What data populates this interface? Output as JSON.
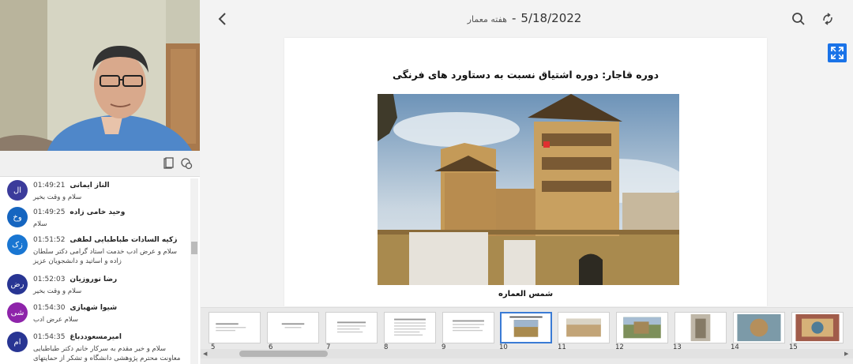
{
  "header": {
    "course_title": "هفته معمار",
    "separator": "-",
    "date": "5/18/2022",
    "icons": {
      "back": "chevron-left-icon",
      "search": "search-icon",
      "rotate": "rotate-icon",
      "fullscreen": "fullscreen-icon"
    }
  },
  "video_toolbar": {
    "icons": [
      "clipboard-icon",
      "chat-bubbles-icon"
    ]
  },
  "chat": {
    "messages": [
      {
        "avatar": "ال",
        "avatar_color": "#3b3b9b",
        "name": "الناز ایمانی",
        "time": "01:49:21",
        "text": "سلام و وقت بخیر"
      },
      {
        "avatar": "وخ",
        "avatar_color": "#1565c0",
        "name": "وحید خامی زاده",
        "time": "01:49:25",
        "text": "سلام"
      },
      {
        "avatar": "زک",
        "avatar_color": "#1976d2",
        "name": "زکیه السادات طباطبایی لطفی",
        "time": "01:51:52",
        "text": "سلام و عرض ادب خدمت استاد گرامی دکتر سلطان زاده و اساتید و دانشجویان عزیز"
      },
      {
        "avatar": "رض",
        "avatar_color": "#283593",
        "name": "رضا نوروزیان",
        "time": "01:52:03",
        "text": "سلام و وقت بخیر"
      },
      {
        "avatar": "شی",
        "avatar_color": "#8e24aa",
        "name": "شیوا شهبازی",
        "time": "01:54:30",
        "text": "سلام عرض ادب"
      },
      {
        "avatar": "ام",
        "avatar_color": "#283593",
        "name": "امیرمسعود‌دباغ",
        "time": "01:54:35",
        "text": "سلام و خیر مقدم به سرکار خانم دکتر طباطبایی معاونت محترم پژوهشی دانشگاه و تشکر از حمایتهای بیدریغشان"
      }
    ]
  },
  "slide": {
    "title": "دوره قاجار: دوره اشتیاق نسبت به دستاورد های فرنگی",
    "caption": "شمس العماره"
  },
  "thumbnails": {
    "items": [
      {
        "num": "5"
      },
      {
        "num": "6"
      },
      {
        "num": "7"
      },
      {
        "num": "8"
      },
      {
        "num": "9"
      },
      {
        "num": "10",
        "active": true
      },
      {
        "num": "11"
      },
      {
        "num": "12"
      },
      {
        "num": "13"
      },
      {
        "num": "14"
      },
      {
        "num": "15"
      }
    ]
  }
}
